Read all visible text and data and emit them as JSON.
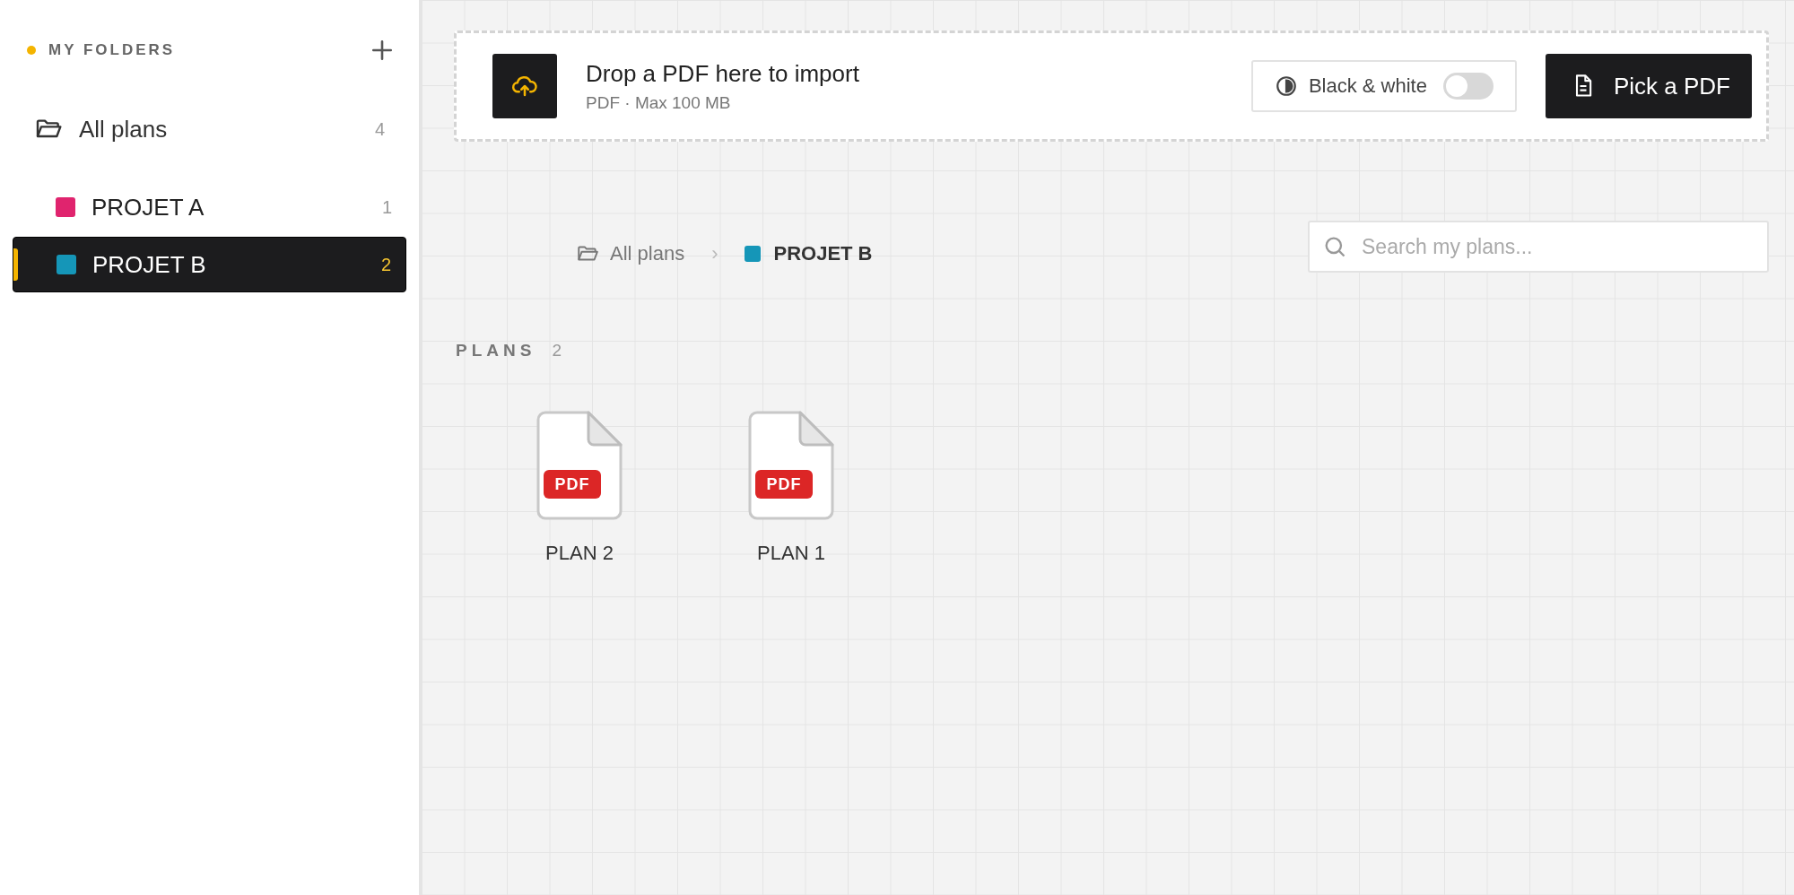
{
  "sidebar": {
    "heading": "MY FOLDERS",
    "all_plans": {
      "label": "All plans",
      "count": "4"
    },
    "folders": [
      {
        "label": "PROJET A",
        "count": "1",
        "color": "#e0246e",
        "selected": false
      },
      {
        "label": "PROJET B",
        "count": "2",
        "color": "#1596b8",
        "selected": true
      }
    ]
  },
  "import_bar": {
    "title": "Drop a PDF here to import",
    "subtitle": "PDF · Max 100 MB",
    "toggle": {
      "label": "Black & white",
      "on": false
    },
    "button": "Pick a PDF"
  },
  "breadcrumb": {
    "root": "All plans",
    "separator": "›",
    "current": {
      "label": "PROJET B",
      "color": "#1596b8"
    }
  },
  "search": {
    "placeholder": "Search my plans..."
  },
  "plans": {
    "heading": "PLANS",
    "count": "2",
    "items": [
      {
        "name": "PLAN 2",
        "badge": "PDF"
      },
      {
        "name": "PLAN 1",
        "badge": "PDF"
      }
    ]
  }
}
